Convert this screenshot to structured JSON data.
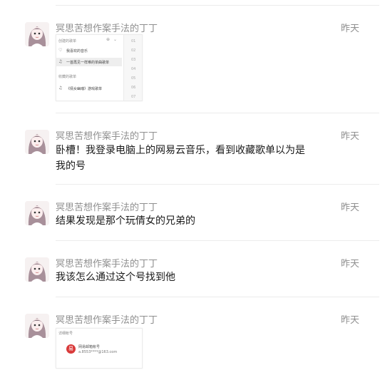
{
  "messages": [
    {
      "name": "冥思苦想作案手法的丁丁",
      "time": "昨天",
      "text": ""
    },
    {
      "name": "冥思苦想作案手法的丁丁",
      "time": "昨天",
      "text": "卧槽！我登录电脑上的网易云音乐，看到收藏歌单以为是我的号"
    },
    {
      "name": "冥思苦想作案手法的丁丁",
      "time": "昨天",
      "text": "结果发现是那个玩倩女的兄弟的"
    },
    {
      "name": "冥思苦想作案手法的丁丁",
      "time": "昨天",
      "text": "我该怎么通过这个号找到他"
    },
    {
      "name": "冥思苦想作案手法的丁丁",
      "time": "昨天",
      "text": ""
    }
  ],
  "screenshot1": {
    "section_created": "创建的歌单",
    "item_liked": "我喜欢的音乐",
    "item_playlist": "一首再见一样难的单曲歌单",
    "section_collected": "收藏的歌单",
    "item_collected": "《倩女幽魂》游戏歌单",
    "sidebar_rows": [
      "01",
      "02",
      "03",
      "04",
      "05",
      "06",
      "07"
    ],
    "heart_icon": "heart-icon",
    "music_icon": "music-note-icon"
  },
  "screenshot2": {
    "header": "详细帐号",
    "icon_char": "易",
    "line1": "网易邮箱帐号",
    "line2": "a.8553****@163.com",
    "icon_color": "#d93a3a"
  },
  "colors": {
    "name": "#8f8f8f",
    "time": "#8f8f8f",
    "text": "#1a1a1a",
    "divider": "#ececec"
  }
}
